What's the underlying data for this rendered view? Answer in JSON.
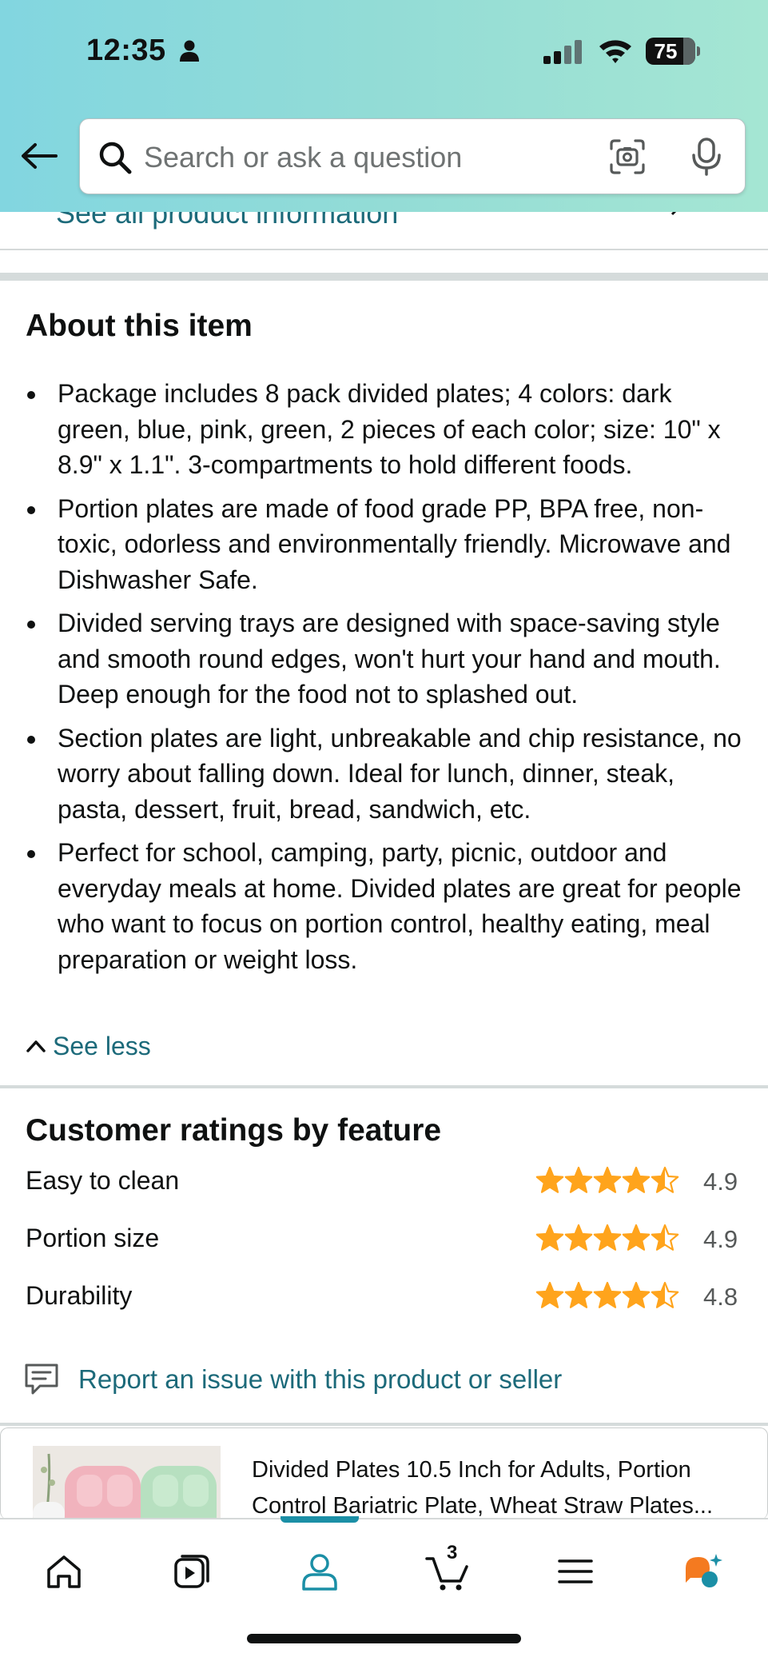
{
  "status_bar": {
    "time": "12:35",
    "battery": "75",
    "battery_level": 0.75
  },
  "header": {
    "search_placeholder": "Search or ask a question"
  },
  "cutoff_row": {
    "label": "See all product information"
  },
  "about": {
    "title": "About this item",
    "bullets": [
      "Package includes 8 pack divided plates; 4 colors: dark green, blue, pink, green, 2 pieces of each color; size: 10\" x 8.9\" x 1.1\". 3-compartments to hold different foods.",
      "Portion plates are made of food grade PP, BPA free, non-toxic, odorless and environmentally friendly. Microwave and Dishwasher Safe.",
      "Divided serving trays are designed with space-saving style and smooth round edges, won't hurt your hand and mouth. Deep enough for the food not to splashed out.",
      "Section plates are light, unbreakable and chip resistance, no worry about falling down. Ideal for lunch, dinner, steak, pasta, dessert, fruit, bread, sandwich, etc.",
      "Perfect for school, camping, party, picnic, outdoor and everyday meals at home. Divided plates are great for people who want to focus on portion control, healthy eating, meal preparation or weight loss."
    ],
    "see_less": "See less"
  },
  "ratings": {
    "title": "Customer ratings by feature",
    "star_color": "#ffa41c",
    "items": [
      {
        "label": "Easy to clean",
        "value": "4.9"
      },
      {
        "label": "Portion size",
        "value": "4.9"
      },
      {
        "label": "Durability",
        "value": "4.8"
      }
    ]
  },
  "report": {
    "label": "Report an issue with this product or seller"
  },
  "product_card": {
    "title": "Divided Plates 10.5 Inch for Adults, Portion Control Bariatric Plate, Wheat Straw Plates..."
  },
  "bottom_nav": {
    "cart_count": "3",
    "active_tab": "account",
    "accent_color": "#1b8fa6"
  }
}
